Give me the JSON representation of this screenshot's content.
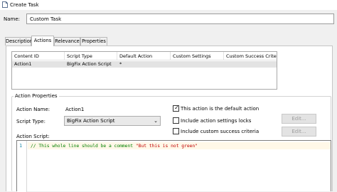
{
  "window": {
    "title": "Create Task"
  },
  "name_field": {
    "label": "Name:",
    "value": "Custom Task"
  },
  "tabs": [
    {
      "label": "Description",
      "active": false
    },
    {
      "label": "Actions",
      "active": true
    },
    {
      "label": "Relevance",
      "active": false
    },
    {
      "label": "Properties",
      "active": false
    }
  ],
  "actions_grid": {
    "columns": [
      "Content ID",
      "Script Type",
      "Default Action",
      "Custom Settings",
      "Custom Success Crite..."
    ],
    "rows": [
      {
        "content_id": "Action1",
        "script_type": "BigFix Action Script",
        "default_action": "*",
        "custom_settings": "",
        "custom_success": ""
      }
    ]
  },
  "action_properties": {
    "group_label": "Action Properties",
    "action_name_label": "Action Name:",
    "action_name_value": "Action1",
    "script_type_label": "Script Type:",
    "script_type_value": "BigFix Action Script",
    "action_script_label": "Action Script:",
    "default_action_checkbox": {
      "label": "This action is the default action",
      "checked": true
    },
    "settings_locks_checkbox": {
      "label": "Include action settings locks",
      "checked": false
    },
    "success_criteria_checkbox": {
      "label": "Include custom success criteria",
      "checked": false
    },
    "edit_button_label": "Edit...",
    "edit_button2_label": "Edit..."
  },
  "editor": {
    "line_number": "1",
    "comment_text": "// This whole line should be a comment ",
    "string_text": "\"But this is not green\""
  },
  "colors": {
    "comment": "#008000",
    "string": "#c00000",
    "line_number": "#2b91af",
    "selected_row": "#e3e3e3"
  }
}
